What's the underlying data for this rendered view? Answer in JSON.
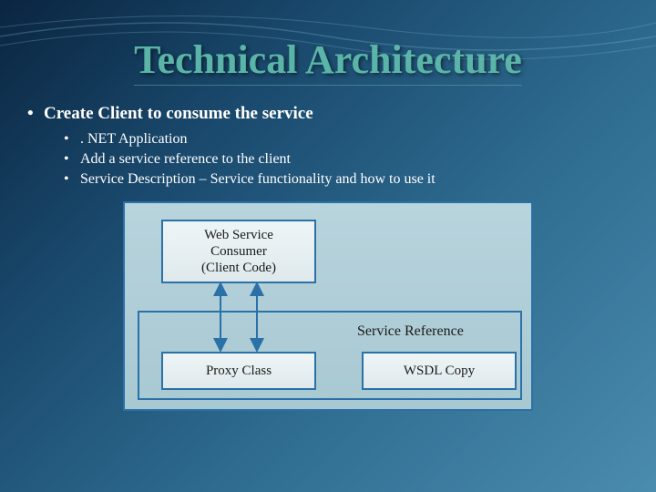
{
  "title": "Technical Architecture",
  "main_bullet": "Create Client to consume the service",
  "sub_bullets": [
    ". NET Application",
    "Add a service reference to the client",
    "Service Description – Service functionality and how to use it"
  ],
  "diagram": {
    "consumer_box": "Web Service Consumer (Client Code)",
    "consumer_line1": "Web Service",
    "consumer_line2": "Consumer",
    "consumer_line3": "(Client Code)",
    "proxy_box": "Proxy Class",
    "wsdl_box": "WSDL Copy",
    "service_ref_label": "Service Reference"
  }
}
